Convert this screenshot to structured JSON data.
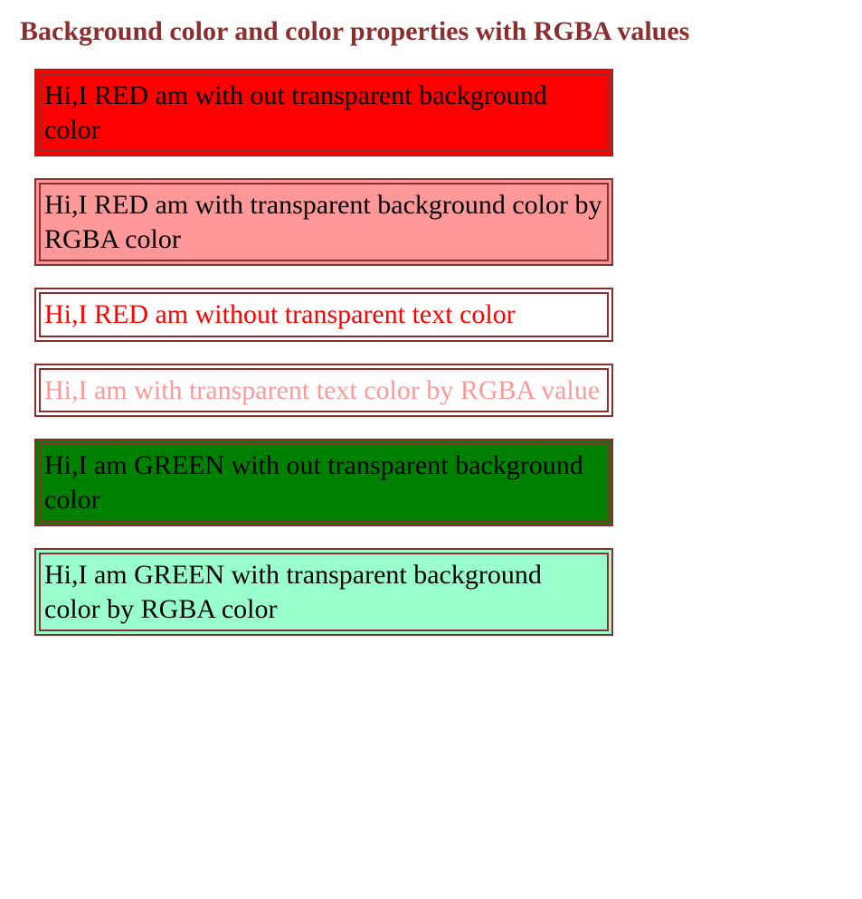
{
  "title": "Background color and color properties with RGBA values",
  "boxes": [
    {
      "text": "Hi,I RED am with out transparent background color"
    },
    {
      "text": "Hi,I RED am with transparent background color by RGBA color"
    },
    {
      "text": "Hi,I RED am without transparent text color"
    },
    {
      "text": "Hi,I am with transparent text color by RGBA value"
    },
    {
      "text": "Hi,I am GREEN with out transparent background color"
    },
    {
      "text": "Hi,I am GREEN with transparent background color by RGBA color"
    }
  ]
}
